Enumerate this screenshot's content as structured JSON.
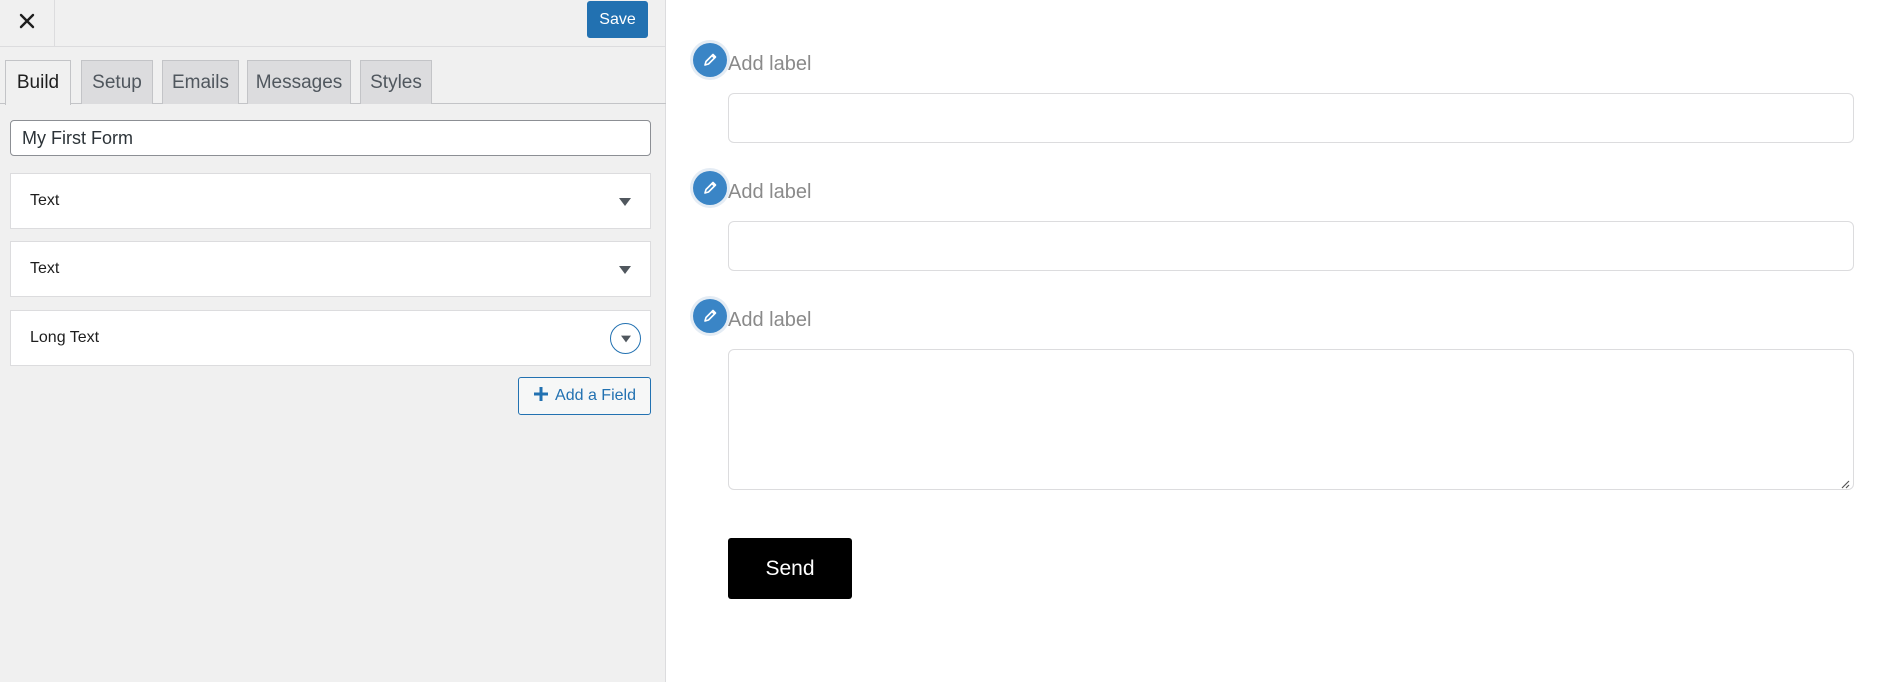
{
  "toolbar": {
    "close_icon": "close-icon",
    "save_label": "Save"
  },
  "tabs": [
    {
      "label": "Build",
      "active": true
    },
    {
      "label": "Setup",
      "active": false
    },
    {
      "label": "Emails",
      "active": false
    },
    {
      "label": "Messages",
      "active": false
    },
    {
      "label": "Styles",
      "active": false
    }
  ],
  "form_name": {
    "value": "My First Form"
  },
  "fields": [
    {
      "label": "Text",
      "icon": "chevron-down-icon"
    },
    {
      "label": "Text",
      "icon": "chevron-down-icon"
    },
    {
      "label": "Long Text",
      "icon": "chevron-down-circle-icon"
    }
  ],
  "add_field": {
    "label": "Add a Field",
    "icon": "plus-icon"
  },
  "preview": {
    "fields": [
      {
        "label": "Add label",
        "type": "text"
      },
      {
        "label": "Add label",
        "type": "text"
      },
      {
        "label": "Add label",
        "type": "textarea"
      }
    ],
    "submit_label": "Send"
  },
  "colors": {
    "accent": "#2271b1",
    "edit_icon": "#3a85c6",
    "sidebar_bg": "#f0f0f0",
    "send_bg": "#000000"
  }
}
